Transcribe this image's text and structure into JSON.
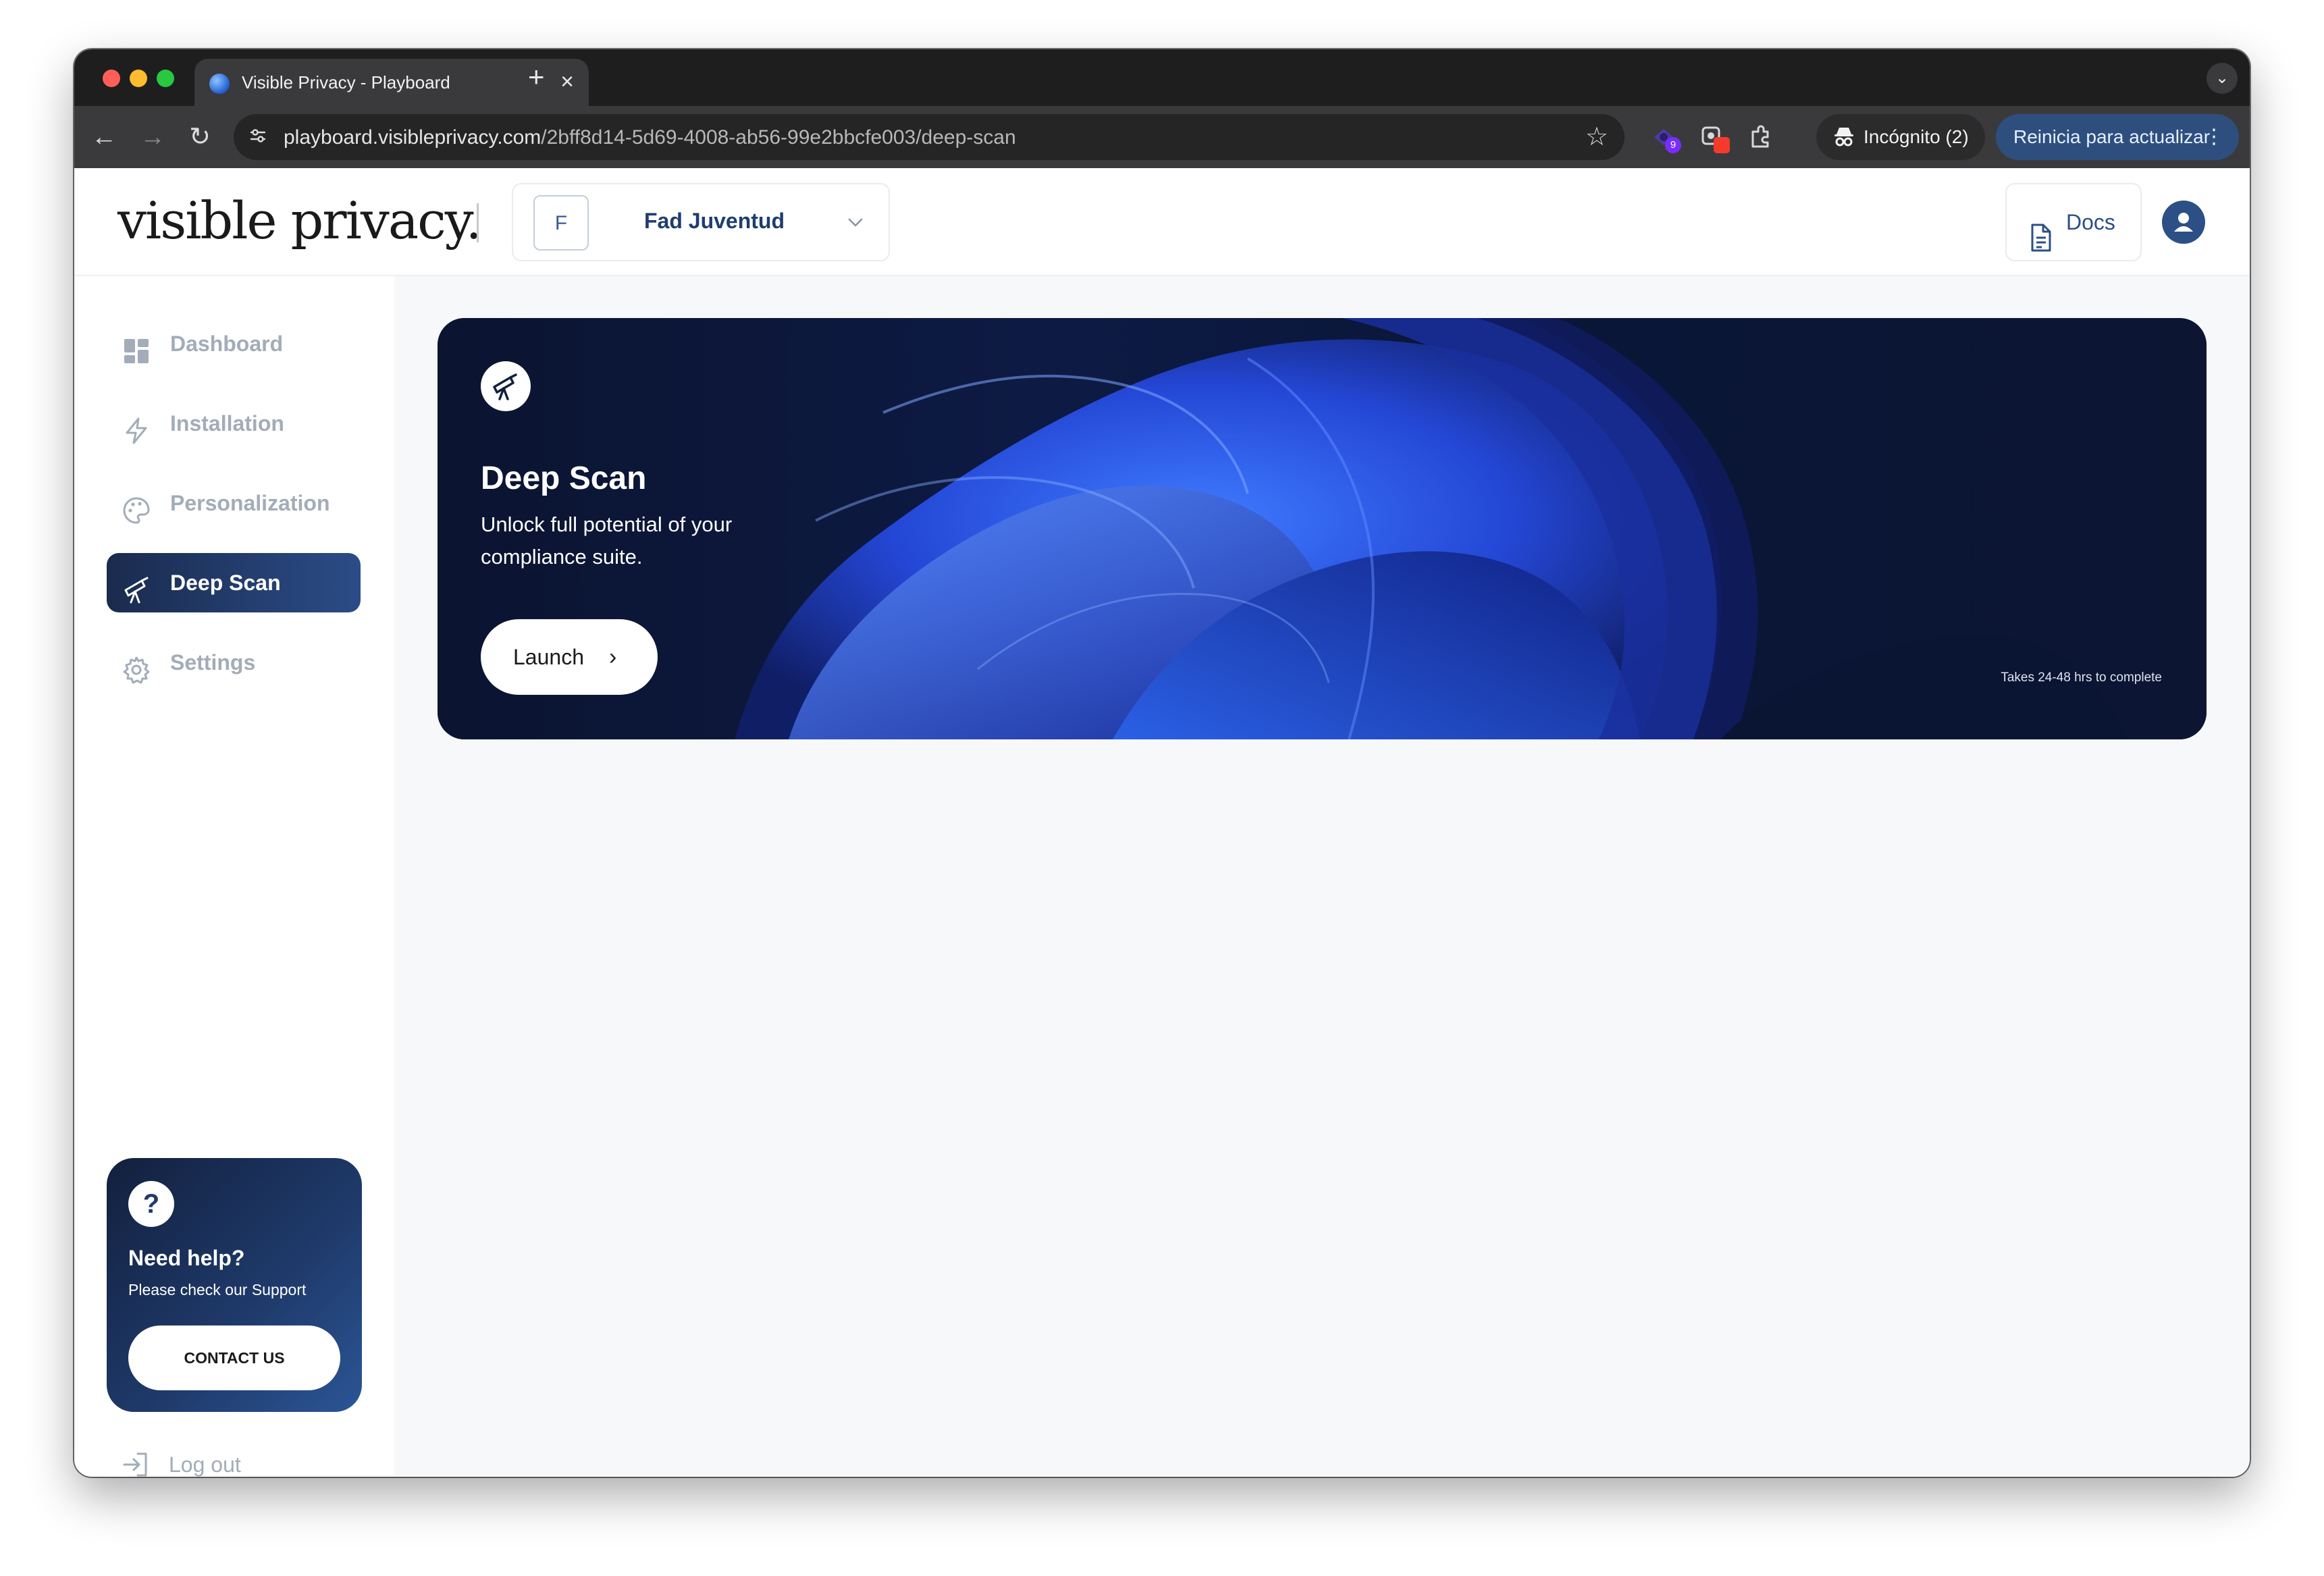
{
  "browser": {
    "tab_title": "Visible Privacy - Playboard",
    "url_domain": "playboard.visibleprivacy.com",
    "url_path": "/2bff8d14-5d69-4008-ab56-99e2bbcfe003/deep-scan",
    "incognito_label": "Incógnito (2)",
    "update_label": "Reinicia para actualizar",
    "extension_badge": "9"
  },
  "header": {
    "logo": "visible privacy.",
    "org_initial": "F",
    "org_name": "Fad Juventud",
    "docs_label": "Docs"
  },
  "sidebar": {
    "items": [
      {
        "label": "Dashboard",
        "icon": "dashboard-icon"
      },
      {
        "label": "Installation",
        "icon": "lightning-icon"
      },
      {
        "label": "Personalization",
        "icon": "palette-icon"
      },
      {
        "label": "Deep Scan",
        "icon": "telescope-icon",
        "active": true
      },
      {
        "label": "Settings",
        "icon": "gear-icon"
      }
    ],
    "help": {
      "title": "Need help?",
      "subtitle": "Please check our Support",
      "button": "CONTACT US"
    },
    "logout_label": "Log out"
  },
  "banner": {
    "title": "Deep Scan",
    "description": "Unlock full potential of your compliance suite.",
    "button": "Launch",
    "note": "Takes 24-48 hrs to complete"
  },
  "colors": {
    "brand_navy": "#1f3b6c",
    "active_nav": "#2b4c88",
    "banner_bg": "#0c1633",
    "muted_nav": "#a3acb8"
  }
}
